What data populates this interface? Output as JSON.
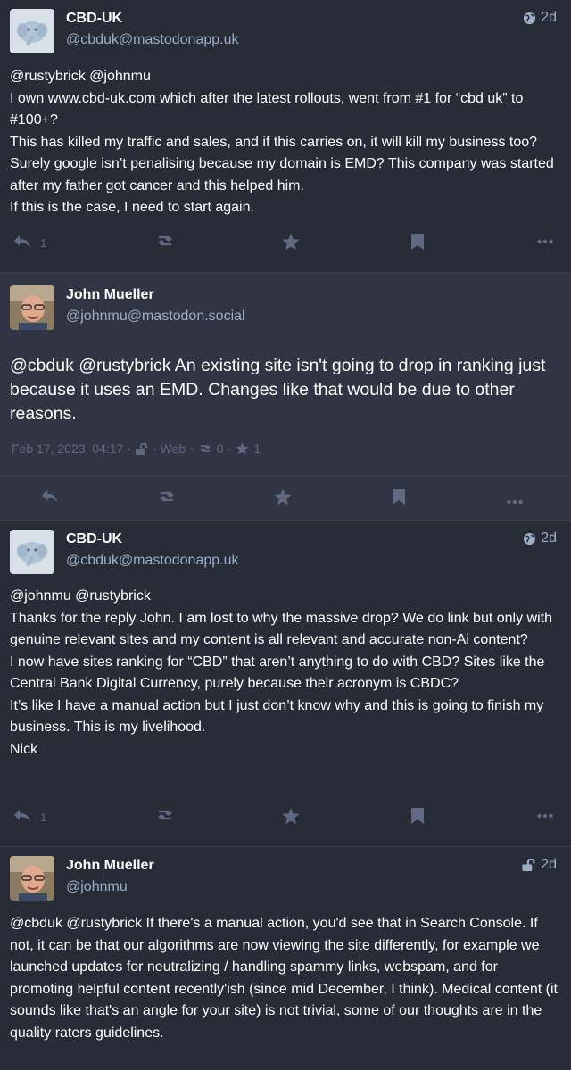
{
  "posts": [
    {
      "display_name": "CBD-UK",
      "acct": "@cbduk@mastodonapp.uk",
      "time": "2d",
      "visibility_icon": "globe-icon",
      "paragraphs": [
        "@rustybrick @johnmu",
        "I own www.cbd-uk.com which after the latest rollouts, went from #1 for “cbd uk” to #100+?",
        "This has killed my traffic and sales, and if this carries on, it will kill my business too? Surely google isn’t penalising because my domain is EMD? This company was started after my father got cancer and this helped him.",
        "If this is the case, I need to start again."
      ],
      "reply_count": "1"
    },
    {
      "display_name": "John Mueller",
      "acct": "@johnmu@mastodon.social",
      "paragraphs": [
        "@cbduk @rustybrick An existing site isn't going to drop in ranking just because it uses an EMD. Changes like that would be due to other reasons."
      ],
      "timestamp": "Feb 17, 2023, 04:17",
      "app": "Web",
      "boost_count": "0",
      "fav_count": "1"
    },
    {
      "display_name": "CBD-UK",
      "acct": "@cbduk@mastodonapp.uk",
      "time": "2d",
      "visibility_icon": "globe-icon",
      "paragraphs": [
        "@johnmu @rustybrick",
        "Thanks for the reply John. I am lost to why the massive drop? We do link but only with genuine relevant sites and my content is all relevant and accurate non-Ai content?",
        "I now have sites ranking for “CBD” that aren’t anything to do with CBD? Sites like the Central Bank Digital Currency, purely because their acronym is CBDC?",
        "It’s like I have a manual action but I just don’t know why and this is going to finish my business. This is my livelihood.",
        "Nick"
      ],
      "reply_count": "1"
    },
    {
      "display_name": "John Mueller",
      "acct": "@johnmu",
      "time": "2d",
      "visibility_icon": "unlock-icon",
      "paragraphs": [
        "@cbduk @rustybrick If there's a manual action, you'd see that in Search Console. If not, it can be that our algorithms are now viewing the site differently, for example we launched updates for neutralizing / handling spammy links, webspam, and for promoting helpful content recently'ish (since mid December, I think). Medical content (it sounds like that's an angle for your site) is not trivial, some of our thoughts are in the quality raters guidelines."
      ]
    }
  ],
  "colors": {
    "background": "#282c37",
    "focused": "#313543",
    "muted": "#9baec8",
    "icon": "#606984"
  }
}
